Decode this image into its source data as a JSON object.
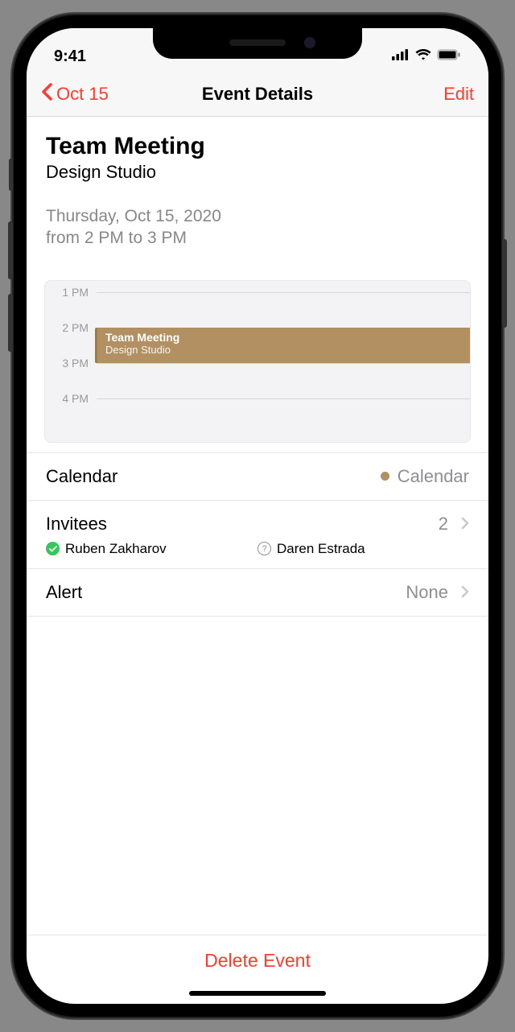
{
  "status": {
    "time": "9:41"
  },
  "nav": {
    "back_label": "Oct 15",
    "title": "Event Details",
    "edit_label": "Edit"
  },
  "event": {
    "title": "Team Meeting",
    "location": "Design Studio",
    "date_line": "Thursday, Oct 15, 2020",
    "time_line": "from 2 PM to 3 PM"
  },
  "timeline": {
    "slots": [
      "1 PM",
      "2 PM",
      "3 PM",
      "4 PM"
    ],
    "block_title": "Team Meeting",
    "block_location": "Design Studio"
  },
  "calendar_row": {
    "label": "Calendar",
    "value": "Calendar"
  },
  "invitees": {
    "label": "Invitees",
    "count": "2",
    "items": [
      {
        "name": "Ruben Zakharov",
        "status": "accepted"
      },
      {
        "name": "Daren Estrada",
        "status": "pending"
      }
    ]
  },
  "alert": {
    "label": "Alert",
    "value": "None"
  },
  "footer": {
    "delete_label": "Delete Event"
  }
}
